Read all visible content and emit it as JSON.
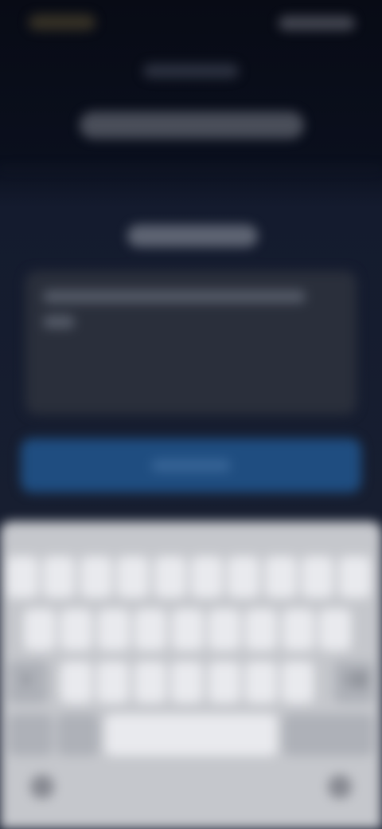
{
  "theme": {
    "background": "#0d1220",
    "text_area_bg": "#2a2f3b",
    "button_bg": "#1f4d80",
    "keyboard_bg": "#c5c7cc",
    "key_bg": "#e9eaee"
  },
  "state": {
    "blurred": true
  },
  "text_area": {
    "line_count": 2
  },
  "keyboard": {
    "row1_keys": 10,
    "row2_keys": 9,
    "row3_keys": 7,
    "shift_icon": "shift-icon",
    "backspace_icon": "backspace-icon",
    "emoji_icon": "emoji-icon",
    "mic_icon": "microphone-icon",
    "shift_glyph": "⇧",
    "backspace_glyph": "⌫"
  }
}
